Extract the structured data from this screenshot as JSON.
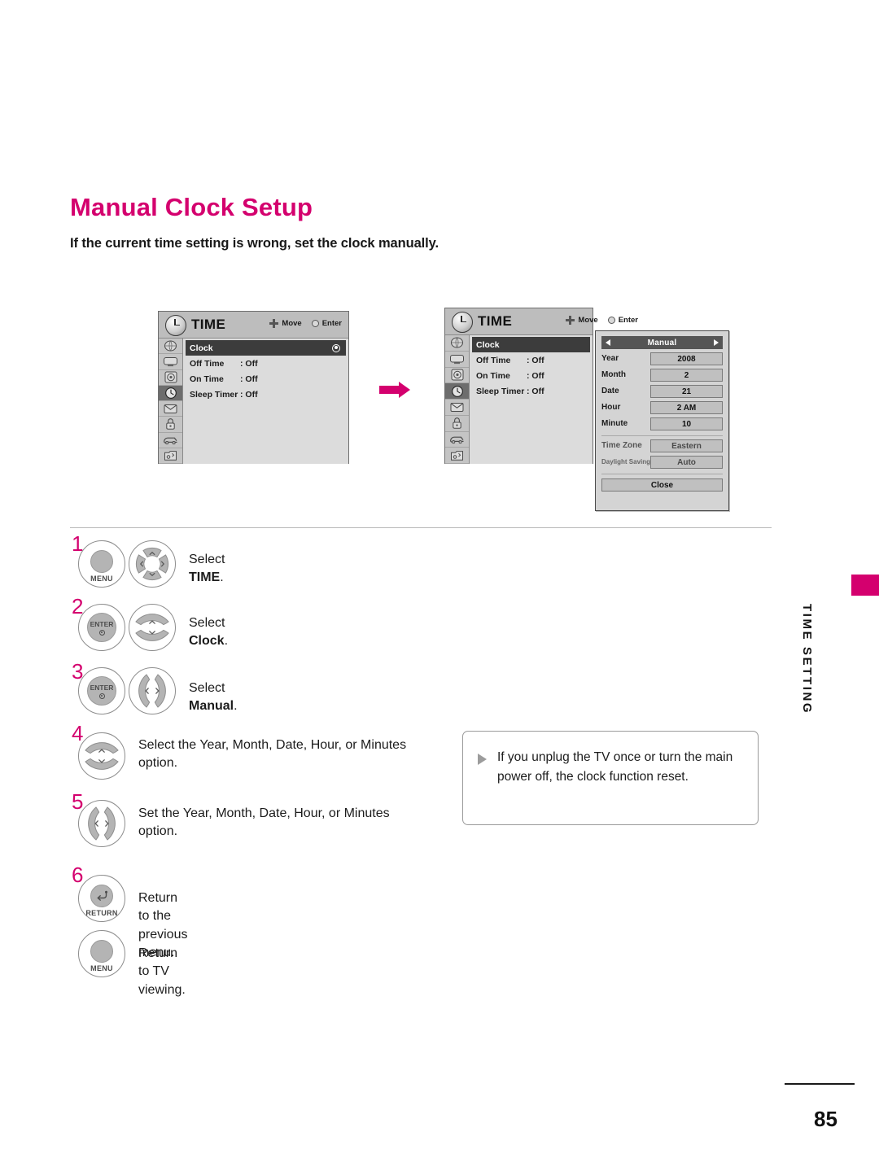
{
  "page": {
    "title": "Manual Clock Setup",
    "subtitle": "If the current time setting is wrong, set the clock manually.",
    "number": "85",
    "side_tab": "TIME SETTING",
    "accent_color": "#d4006e"
  },
  "osd": {
    "title": "TIME",
    "hints": [
      {
        "icon": "navigation-pad-icon",
        "label": "Move"
      },
      {
        "icon": "enter-dot-icon",
        "label": "Enter"
      }
    ],
    "rail_icons": [
      "picture-icon",
      "screen-icon",
      "audio-icon",
      "time-clock-icon",
      "option-icon",
      "lock-icon",
      "input-icon",
      "usb-icon"
    ],
    "rail_selected_index": 3,
    "rows": [
      {
        "label": "Clock",
        "value": "",
        "highlighted": true,
        "radio": true
      },
      {
        "label": "Off Time",
        "value": ": Off",
        "highlighted": false,
        "radio": false
      },
      {
        "label": "On Time",
        "value": ": Off",
        "highlighted": false,
        "radio": false
      },
      {
        "label": "Sleep Timer",
        "value": ": Off",
        "highlighted": false,
        "radio": false
      }
    ]
  },
  "manual_dialog": {
    "title": "Manual",
    "left_arrow": "left-arrow-icon",
    "right_arrow": "right-arrow-icon",
    "fields": [
      {
        "label": "Year",
        "value": "2008"
      },
      {
        "label": "Month",
        "value": "2"
      },
      {
        "label": "Date",
        "value": "21"
      },
      {
        "label": "Hour",
        "value": "2 AM"
      },
      {
        "label": "Minute",
        "value": "10"
      }
    ],
    "extra_fields": [
      {
        "label": "Time Zone",
        "value": "Eastern"
      },
      {
        "label": "Daylight Saving",
        "value": "Auto"
      }
    ],
    "close_label": "Close"
  },
  "flow_arrow": "right-arrow-icon",
  "steps": [
    {
      "number": "1",
      "buttons": [
        {
          "type": "round",
          "label": "MENU",
          "name": "menu-button"
        },
        {
          "type": "dpad4",
          "label": "",
          "name": "navigation-pad-button"
        }
      ],
      "text_plain": "Select ",
      "text_bold": "TIME",
      "text_tail": ".",
      "text_line2": ""
    },
    {
      "number": "2",
      "buttons": [
        {
          "type": "enter",
          "label": "ENTER",
          "name": "enter-button"
        },
        {
          "type": "updown",
          "label": "",
          "name": "up-down-button"
        }
      ],
      "text_plain": "Select ",
      "text_bold": "Clock",
      "text_tail": ".",
      "text_line2": ""
    },
    {
      "number": "3",
      "buttons": [
        {
          "type": "enter",
          "label": "ENTER",
          "name": "enter-button"
        },
        {
          "type": "leftright",
          "label": "",
          "name": "left-right-button"
        }
      ],
      "text_plain": "Select ",
      "text_bold": "Manual",
      "text_tail": ".",
      "text_line2": ""
    },
    {
      "number": "4",
      "buttons": [
        {
          "type": "updown",
          "label": "",
          "name": "up-down-button"
        }
      ],
      "text_plain": "Select the Year, Month, Date, Hour, or Minutes",
      "text_bold": "",
      "text_tail": "",
      "text_line2": "option."
    },
    {
      "number": "5",
      "buttons": [
        {
          "type": "leftright",
          "label": "",
          "name": "left-right-button"
        }
      ],
      "text_plain": "Set  the  Year,  Month,  Date,  Hour,  or  Minutes",
      "text_bold": "",
      "text_tail": "",
      "text_line2": "option."
    },
    {
      "number": "6",
      "buttons": [
        {
          "type": "return",
          "label": "RETURN",
          "name": "return-button"
        }
      ],
      "text_plain": "Return to the previous menu.",
      "text_bold": "",
      "text_tail": "",
      "text_line2": ""
    },
    {
      "number": "",
      "buttons": [
        {
          "type": "round",
          "label": "MENU",
          "name": "menu-button"
        }
      ],
      "text_plain": "Return to TV viewing.",
      "text_bold": "",
      "text_tail": "",
      "text_line2": ""
    }
  ],
  "note": {
    "icon": "triangle-bullet-icon",
    "text": "If you unplug the TV once or turn the main power off, the clock function reset."
  }
}
